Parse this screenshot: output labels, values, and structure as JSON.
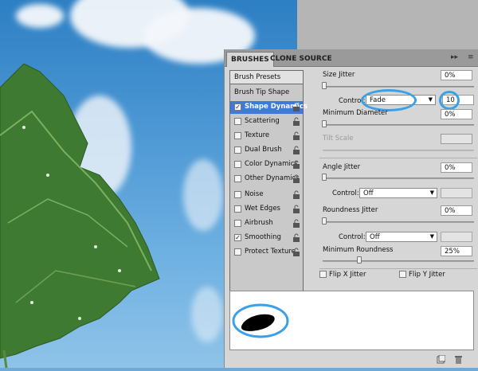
{
  "tabs": {
    "brushes": "BRUSHES",
    "clone_source": "CLONE SOURCE",
    "forward_icon": "▸▸",
    "menu_icon": "≡"
  },
  "left_panel": {
    "presets_button": "Brush Presets",
    "tip_shape": "Brush Tip Shape",
    "options": [
      {
        "label": "Shape Dynamics",
        "checked": true,
        "selected": true,
        "check": "✓"
      },
      {
        "label": "Scattering",
        "checked": false
      },
      {
        "label": "Texture",
        "checked": false
      },
      {
        "label": "Dual Brush",
        "checked": false
      },
      {
        "label": "Color Dynamics",
        "checked": false
      },
      {
        "label": "Other Dynamics",
        "checked": false
      },
      {
        "label": "Noise",
        "checked": false
      },
      {
        "label": "Wet Edges",
        "checked": false
      },
      {
        "label": "Airbrush",
        "checked": false
      },
      {
        "label": "Smoothing",
        "checked": true,
        "check": "✓"
      },
      {
        "label": "Protect Texture",
        "checked": false
      }
    ]
  },
  "settings": {
    "size_jitter": {
      "label": "Size Jitter",
      "value": "0%"
    },
    "control1": {
      "label": "Control:",
      "value": "Fade",
      "number": "10"
    },
    "min_diameter": {
      "label": "Minimum Diameter",
      "value": "0%"
    },
    "tilt_scale": {
      "label": "Tilt Scale"
    },
    "angle_jitter": {
      "label": "Angle Jitter",
      "value": "0%"
    },
    "control2": {
      "label": "Control:",
      "value": "Off"
    },
    "roundness_jitter": {
      "label": "Roundness Jitter",
      "value": "0%"
    },
    "control3": {
      "label": "Control:",
      "value": "Off"
    },
    "min_roundness": {
      "label": "Minimum Roundness",
      "value": "25%"
    },
    "flip_x": "Flip X Jitter",
    "flip_y": "Flip Y Jitter"
  },
  "colors": {
    "highlight": "#3aa0e8",
    "selection": "#3f7ad6"
  }
}
